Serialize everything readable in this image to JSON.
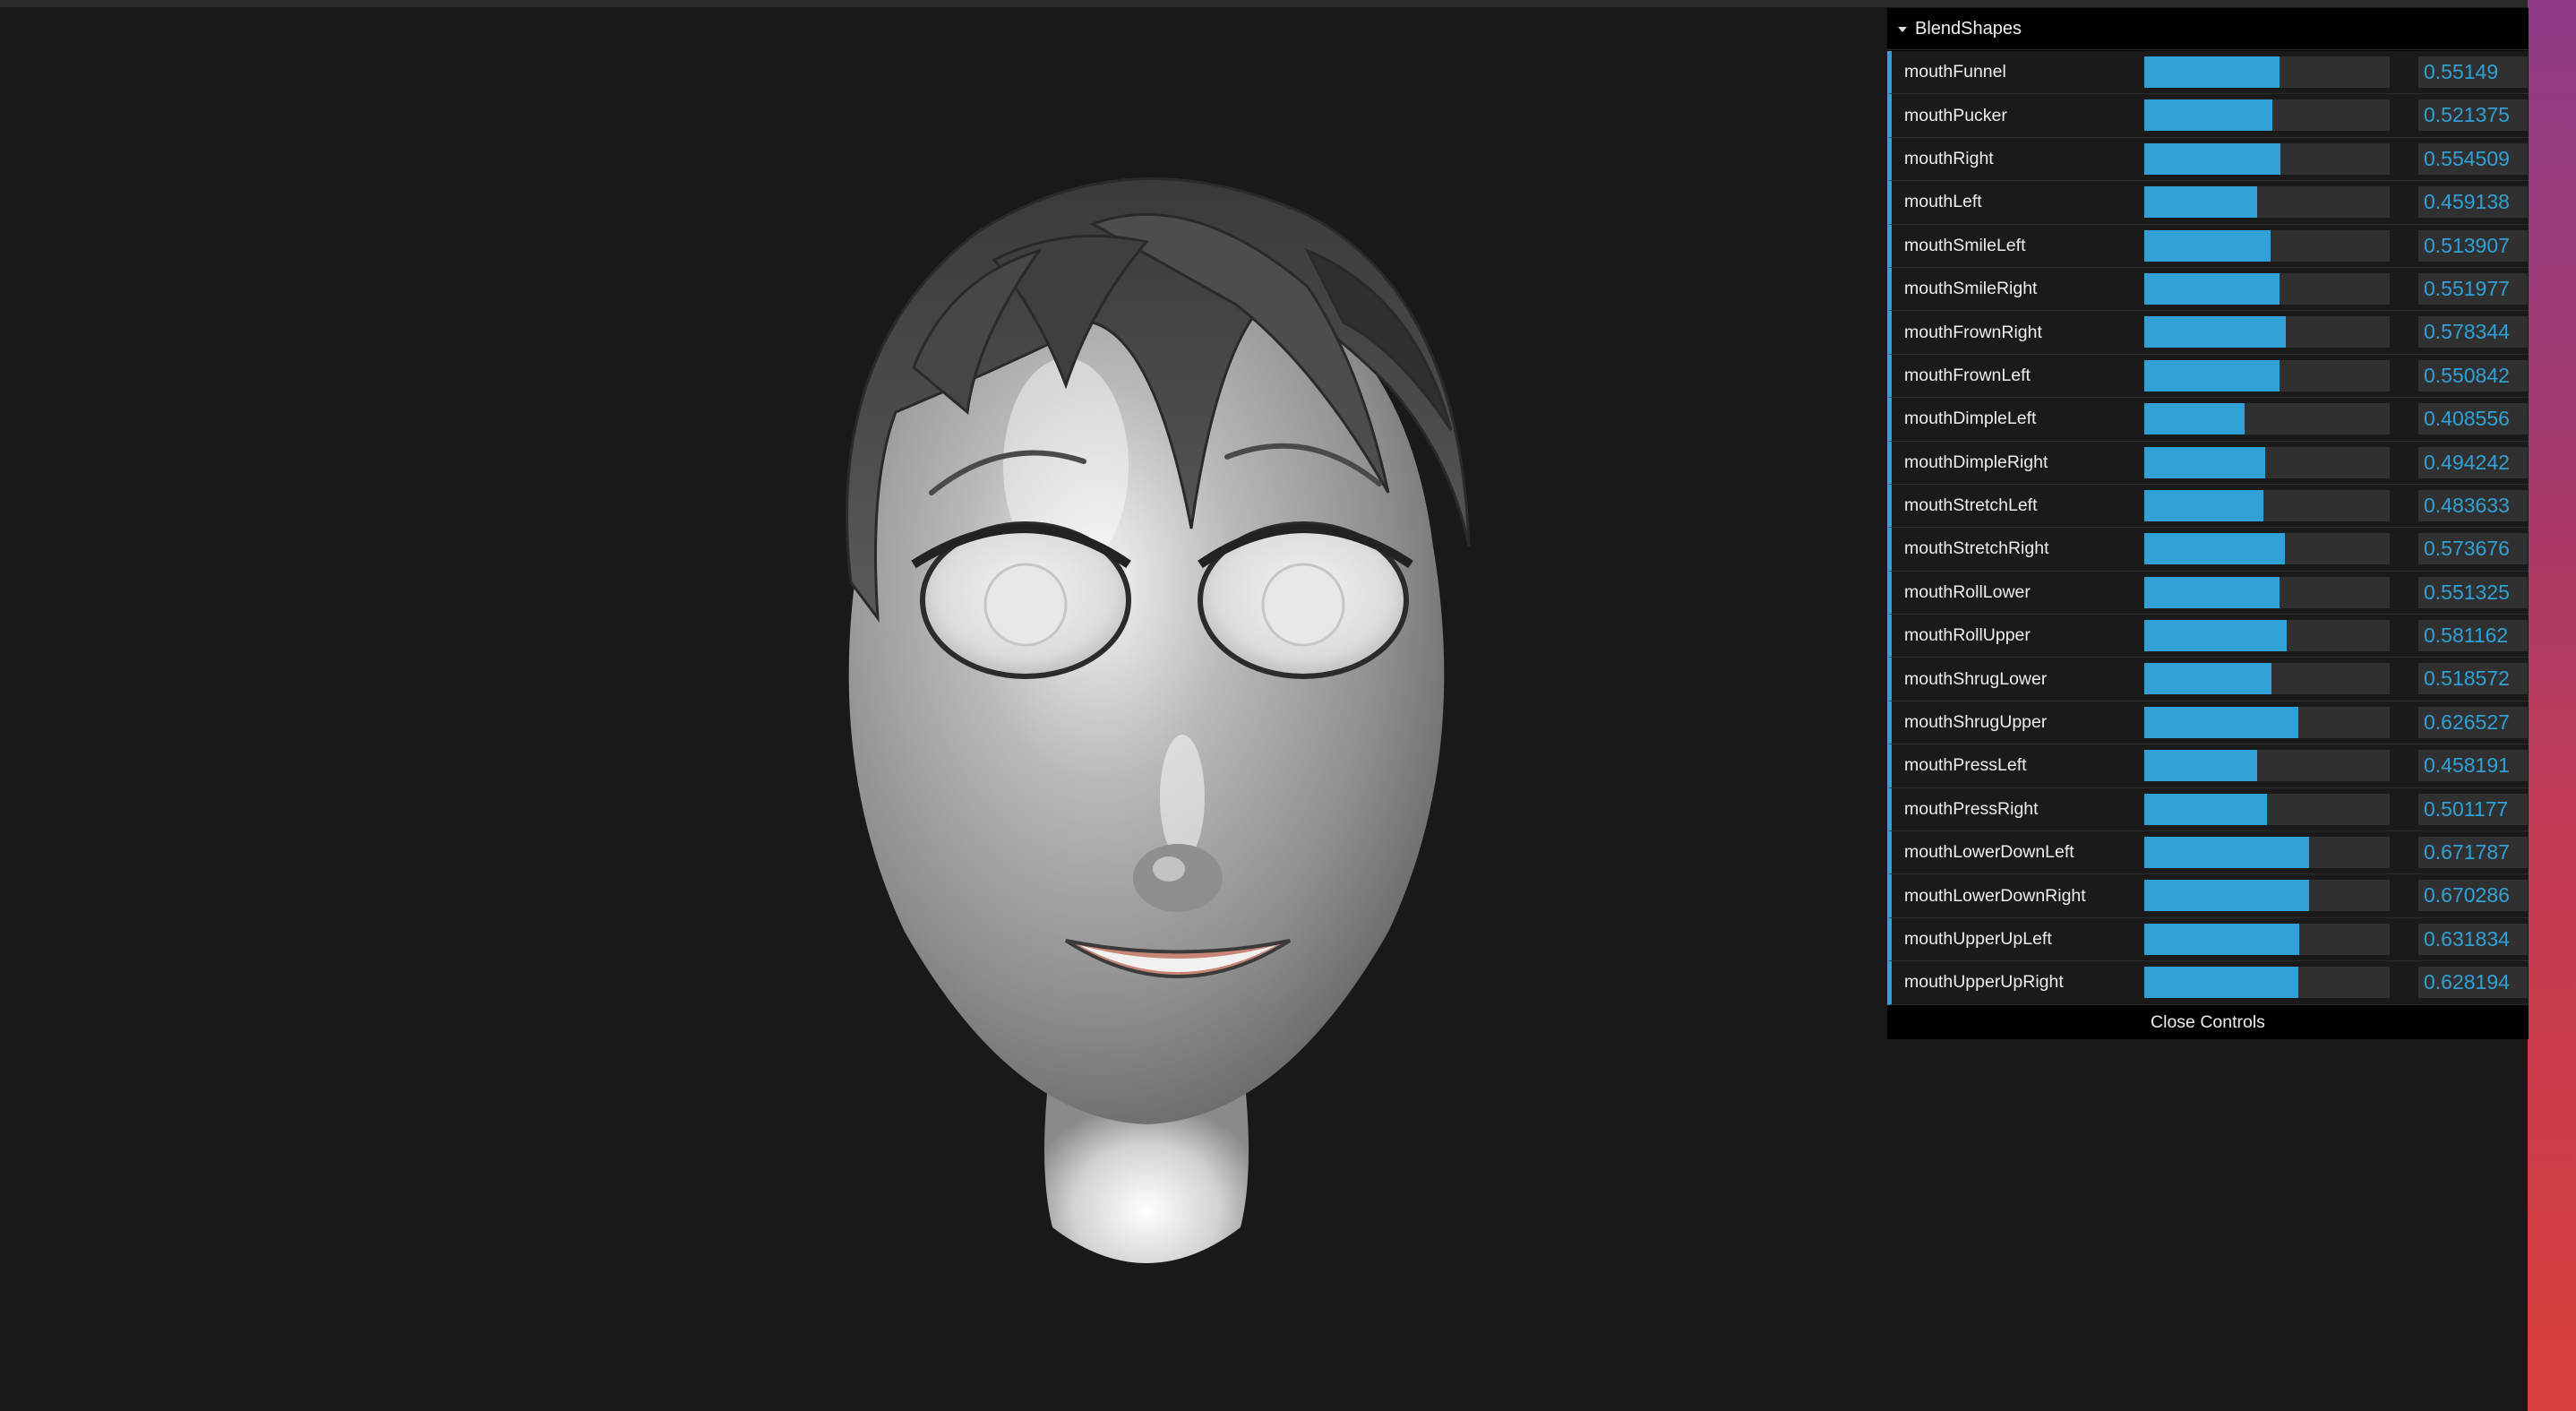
{
  "gui": {
    "folder_title": "BlendShapes",
    "close_label": "Close Controls",
    "accent_color": "#2fa1d6",
    "controls": [
      {
        "name": "mouthFunnel",
        "value": "0.55149"
      },
      {
        "name": "mouthPucker",
        "value": "0.521375"
      },
      {
        "name": "mouthRight",
        "value": "0.554509"
      },
      {
        "name": "mouthLeft",
        "value": "0.459138"
      },
      {
        "name": "mouthSmileLeft",
        "value": "0.513907"
      },
      {
        "name": "mouthSmileRight",
        "value": "0.551977"
      },
      {
        "name": "mouthFrownRight",
        "value": "0.578344"
      },
      {
        "name": "mouthFrownLeft",
        "value": "0.550842"
      },
      {
        "name": "mouthDimpleLeft",
        "value": "0.408556"
      },
      {
        "name": "mouthDimpleRight",
        "value": "0.494242"
      },
      {
        "name": "mouthStretchLeft",
        "value": "0.483633"
      },
      {
        "name": "mouthStretchRight",
        "value": "0.573676"
      },
      {
        "name": "mouthRollLower",
        "value": "0.551325"
      },
      {
        "name": "mouthRollUpper",
        "value": "0.581162"
      },
      {
        "name": "mouthShrugLower",
        "value": "0.518572"
      },
      {
        "name": "mouthShrugUpper",
        "value": "0.626527"
      },
      {
        "name": "mouthPressLeft",
        "value": "0.458191"
      },
      {
        "name": "mouthPressRight",
        "value": "0.501177"
      },
      {
        "name": "mouthLowerDownLeft",
        "value": "0.671787"
      },
      {
        "name": "mouthLowerDownRight",
        "value": "0.670286"
      },
      {
        "name": "mouthUpperUpLeft",
        "value": "0.631834"
      },
      {
        "name": "mouthUpperUpRight",
        "value": "0.628194"
      }
    ]
  },
  "scene": {
    "background_color": "#191919",
    "subject": "stylized-head-model"
  }
}
